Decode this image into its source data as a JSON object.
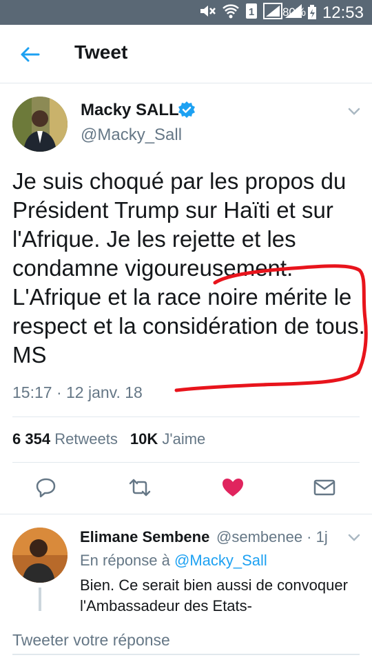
{
  "status_bar": {
    "battery": "80%",
    "time": "12:53",
    "sim_slot": "1"
  },
  "app_bar": {
    "title": "Tweet"
  },
  "tweet": {
    "author_name": "Macky SALL",
    "author_handle": "@Macky_Sall",
    "text": "Je suis choqué par les propos du Président Trump sur Haïti et sur l'Afrique. Je les rejette et les condamne vigoureusement.  L'Afrique et la race noire mérite le respect et la considération de tous. MS",
    "timestamp": "15:17 · 12 janv. 18",
    "retweets_count": "6 354",
    "retweets_label": "Retweets",
    "likes_count": "10K",
    "likes_label": "J'aime"
  },
  "colors": {
    "accent": "#1da1f2",
    "like": "#e0245e",
    "annotation": "#e8141c",
    "status_bar": "#5a6875"
  },
  "reply": {
    "author_name": "Elimane Sembene",
    "author_handle": "@sembenee · 1j",
    "in_reply_to_prefix": "En réponse à",
    "in_reply_to_handle": "@Macky_Sall",
    "text": "Bien. Ce serait bien aussi de convoquer l'Ambassadeur des Etats-"
  },
  "compose": {
    "placeholder": "Tweeter votre réponse"
  },
  "icons": [
    "mute-icon",
    "wifi-icon",
    "sim-icon",
    "signal-icon",
    "battery-icon",
    "back-arrow-icon",
    "verified-icon",
    "chevron-down-icon",
    "reply-icon",
    "retweet-icon",
    "heart-icon",
    "mail-icon"
  ]
}
